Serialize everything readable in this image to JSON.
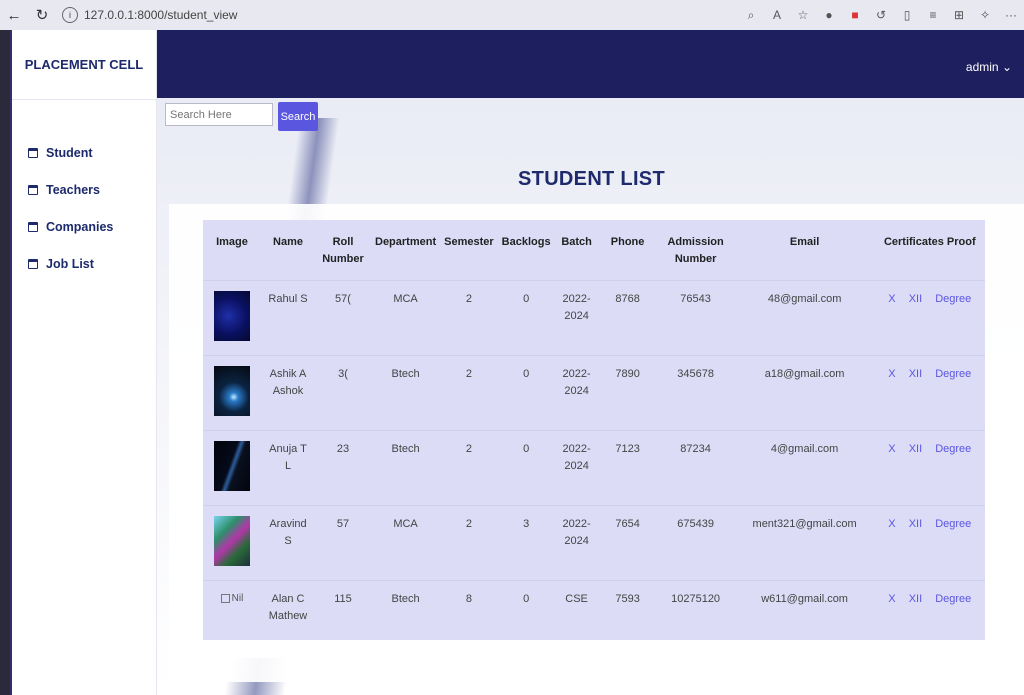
{
  "browser": {
    "url": "127.0.0.1:8000/student_view"
  },
  "sidebar": {
    "brand": "PLACEMENT CELL",
    "items": [
      {
        "label": "Student"
      },
      {
        "label": "Teachers"
      },
      {
        "label": "Companies"
      },
      {
        "label": "Job List"
      }
    ]
  },
  "header": {
    "user": "admin ⌄"
  },
  "search": {
    "placeholder": "Search Here",
    "button": "Search"
  },
  "page": {
    "title": "STUDENT LIST"
  },
  "table": {
    "headers": [
      "Image",
      "Name",
      "Roll Number",
      "Department",
      "Semester",
      "Backlogs",
      "Batch",
      "Phone",
      "Admission Number",
      "Email",
      "Certificates Proof"
    ],
    "rows": [
      {
        "name": "Rahul S",
        "roll": "57(",
        "department": "MCA",
        "semester": "2",
        "backlogs": "0",
        "batch": "2022-2024",
        "phone": "8768",
        "admission": "76543",
        "email": "48@gmail.com",
        "cert": [
          "X",
          "XII",
          "Degree"
        ]
      },
      {
        "name": "Ashik A Ashok",
        "roll": "3(",
        "department": "Btech",
        "semester": "2",
        "backlogs": "0",
        "batch": "2022-2024",
        "phone": "7890",
        "admission": "345678",
        "email": "a18@gmail.com",
        "cert": [
          "X",
          "XII",
          "Degree"
        ]
      },
      {
        "name": "Anuja T L",
        "roll": "23",
        "department": "Btech",
        "semester": "2",
        "backlogs": "0",
        "batch": "2022-2024",
        "phone": "7123",
        "admission": "87234",
        "email": "4@gmail.com",
        "cert": [
          "X",
          "XII",
          "Degree"
        ]
      },
      {
        "name": "Aravind S",
        "roll": "57",
        "department": "MCA",
        "semester": "2",
        "backlogs": "3",
        "batch": "2022-2024",
        "phone": "7654",
        "admission": "675439",
        "email": "ment321@gmail.com",
        "cert": [
          "X",
          "XII",
          "Degree"
        ]
      },
      {
        "name": "Alan C Mathew",
        "roll": "115",
        "department": "Btech",
        "semester": "8",
        "backlogs": "0",
        "batch": "CSE",
        "phone": "7593",
        "admission": "10275120",
        "email": "w611@gmail.com",
        "image_alt": "Nil",
        "cert": [
          "X",
          "XII",
          "Degree"
        ]
      }
    ]
  }
}
